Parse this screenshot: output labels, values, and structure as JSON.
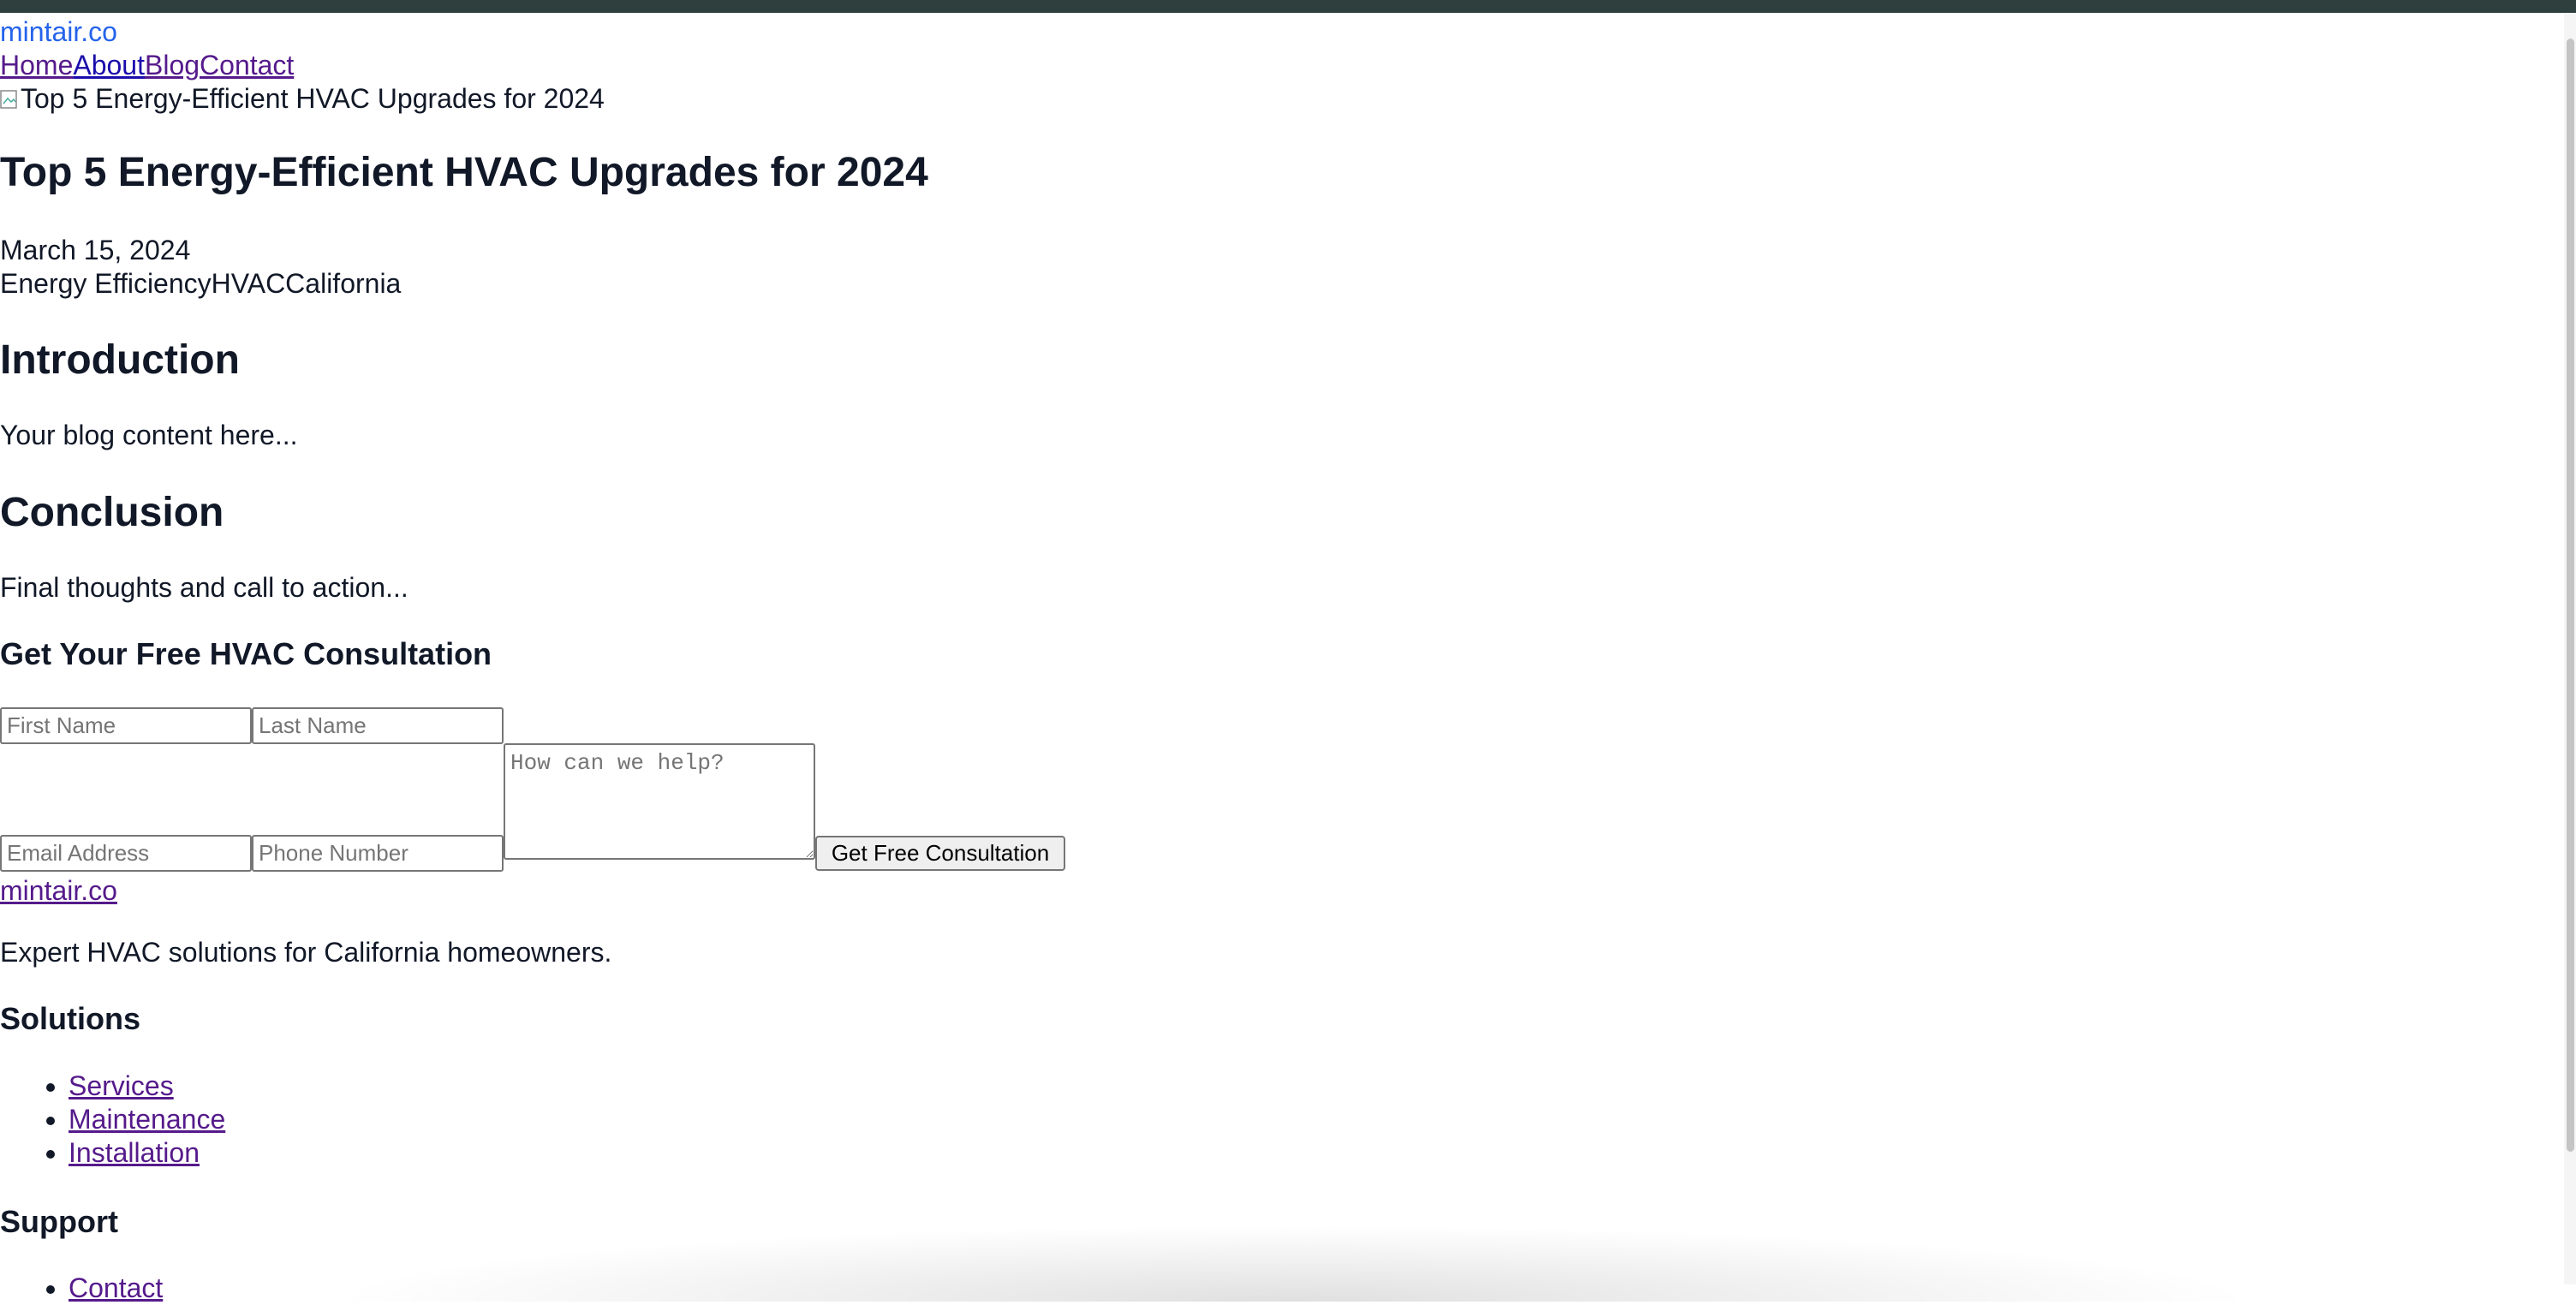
{
  "header": {
    "brand": "mintair.co",
    "nav": [
      {
        "label": "Home"
      },
      {
        "label": "About"
      },
      {
        "label": "Blog"
      },
      {
        "label": "Contact"
      }
    ]
  },
  "article": {
    "image_alt": "Top 5 Energy-Efficient HVAC Upgrades for 2024",
    "title": "Top 5 Energy-Efficient HVAC Upgrades for 2024",
    "date": "March 15, 2024",
    "tags": [
      "Energy Efficiency",
      "HVAC",
      "California"
    ],
    "sections": [
      {
        "heading": "Introduction",
        "body": "Your blog content here..."
      },
      {
        "heading": "Conclusion",
        "body": "Final thoughts and call to action..."
      }
    ]
  },
  "consultation": {
    "heading": "Get Your Free HVAC Consultation",
    "first_name_placeholder": "First Name",
    "last_name_placeholder": "Last Name",
    "email_placeholder": "Email Address",
    "phone_placeholder": "Phone Number",
    "message_placeholder": "How can we help?",
    "submit_label": "Get Free Consultation"
  },
  "footer": {
    "brand": "mintair.co",
    "tagline": "Expert HVAC solutions for California homeowners.",
    "solutions_heading": "Solutions",
    "solutions": [
      "Services",
      "Maintenance",
      "Installation"
    ],
    "support_heading": "Support",
    "support": [
      "Contact"
    ]
  },
  "colors": {
    "topbar": "#2f3f3d",
    "brand_link": "#2563eb",
    "link": "#1a0dab",
    "visited_link": "#551a8b",
    "text": "#111827"
  }
}
